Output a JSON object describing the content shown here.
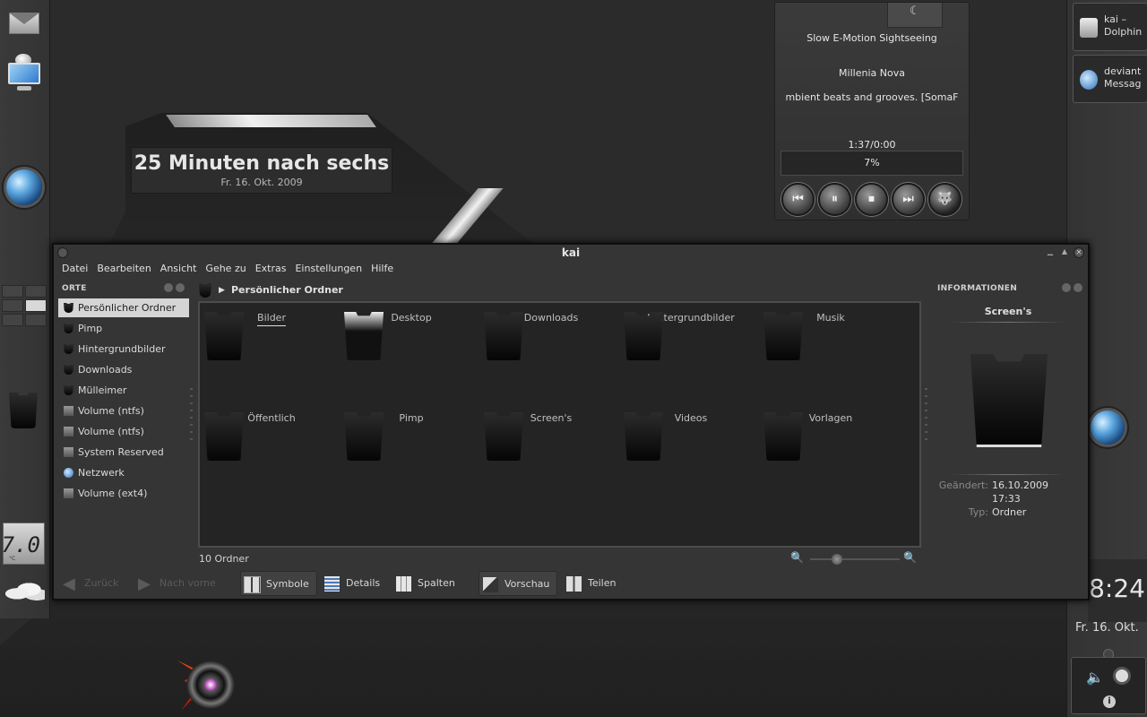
{
  "desktop": {
    "clock_widget": {
      "time_text": "25 Minuten nach sechs",
      "date": "Fr. 16. Okt. 2009"
    },
    "thermometer": {
      "value": "7.0",
      "unit": "°C"
    },
    "pager": {
      "active_index": 3
    }
  },
  "player": {
    "track_title": "Slow E-Motion Sightseeing",
    "artist": "Millenia Nova",
    "station": "mbient beats and grooves. [SomaF",
    "time": "1:37/0:00",
    "progress_text": "7%",
    "buttons": [
      "previous",
      "pause",
      "stop",
      "next",
      "player"
    ]
  },
  "taskbar": {
    "tasks": [
      {
        "line1": "kai –",
        "line2": "Dolphin",
        "icon": "drive-icon"
      },
      {
        "line1": "deviant",
        "line2": "Messag",
        "icon": "messenger-icon"
      }
    ],
    "clock": "8:24",
    "date": "Fr. 16. Okt."
  },
  "window": {
    "title": "kai",
    "menu": [
      "Datei",
      "Bearbeiten",
      "Ansicht",
      "Gehe zu",
      "Extras",
      "Einstellungen",
      "Hilfe"
    ],
    "places": {
      "header": "ORTE",
      "items": [
        {
          "label": "Persönlicher Ordner",
          "icon": "home-folder-icon",
          "selected": true
        },
        {
          "label": "Pimp",
          "icon": "folder-icon"
        },
        {
          "label": "Hintergrundbilder",
          "icon": "folder-icon"
        },
        {
          "label": "Downloads",
          "icon": "folder-icon"
        },
        {
          "label": "Mülleimer",
          "icon": "trash-icon"
        },
        {
          "label": "Volume (ntfs)",
          "icon": "drive-icon"
        },
        {
          "label": "Volume (ntfs)",
          "icon": "drive-icon"
        },
        {
          "label": "System Reserved",
          "icon": "drive-icon"
        },
        {
          "label": "Netzwerk",
          "icon": "network-icon"
        },
        {
          "label": "Volume (ext4)",
          "icon": "drive-icon"
        }
      ]
    },
    "breadcrumb": "Persönlicher Ordner",
    "files": [
      "Bilder",
      "Desktop",
      "Downloads",
      "Hintergrundbilder",
      "Musik",
      "Öffentlich",
      "Pimp",
      "Screen's",
      "Videos",
      "Vorlagen"
    ],
    "status": "10 Ordner",
    "toolbar": {
      "back": "Zurück",
      "forward": "Nach vorne",
      "icons": "Symbole",
      "details": "Details",
      "columns": "Spalten",
      "preview": "Vorschau",
      "split": "Teilen"
    },
    "info": {
      "header": "INFORMATIONEN",
      "title": "Screen's",
      "modified_label": "Geändert:",
      "modified_value": "16.10.2009",
      "modified_time": "17:33",
      "type_label": "Typ:",
      "type_value": "Ordner"
    }
  }
}
